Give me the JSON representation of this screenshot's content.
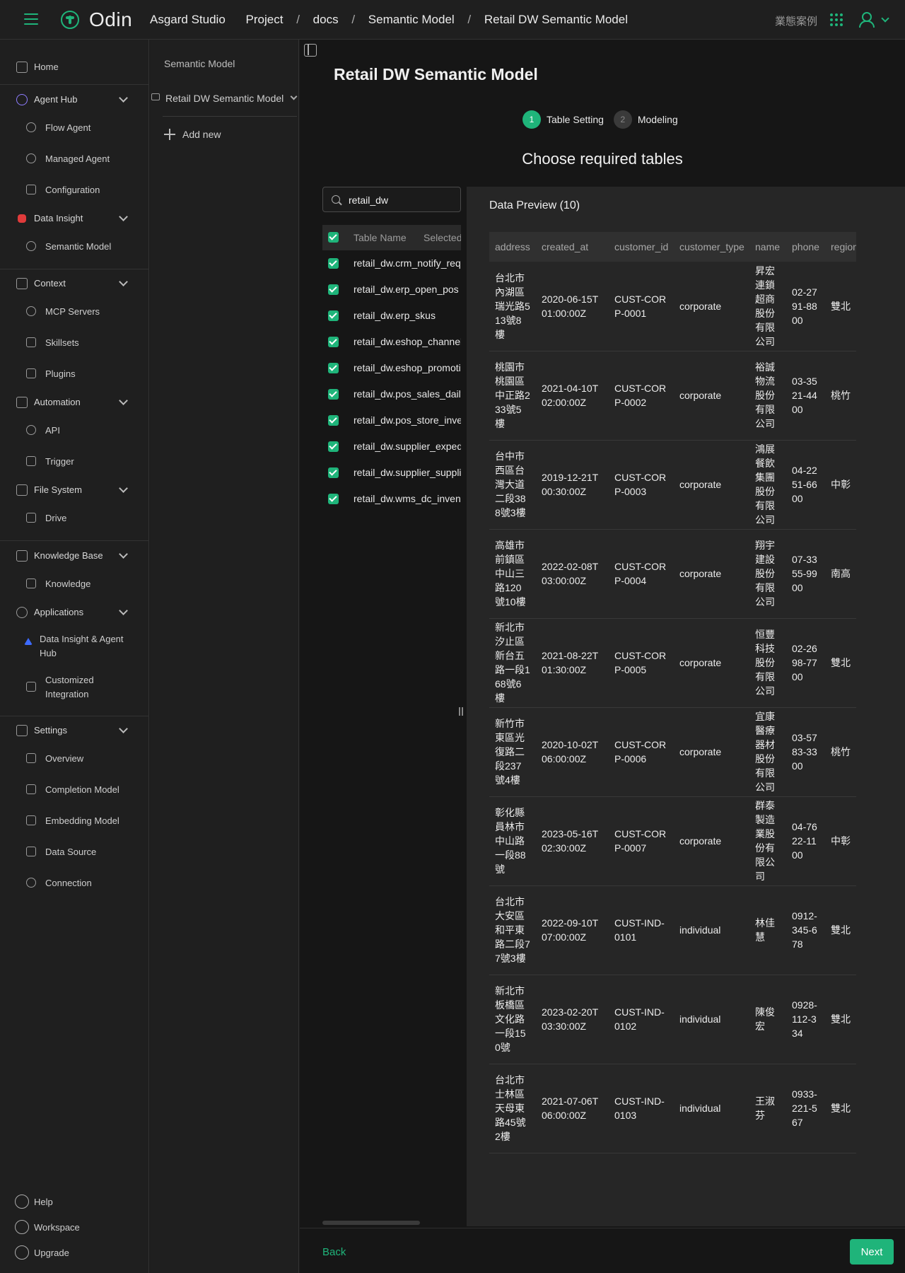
{
  "topbar": {
    "brand": "Odin",
    "studio": "Asgard Studio",
    "breadcrumb": [
      "Project",
      "docs",
      "Semantic Model",
      "Retail DW Semantic Model"
    ],
    "right_text": "業態案例"
  },
  "sidebar": {
    "home": "Home",
    "agent_hub": "Agent Hub",
    "flow_agent": "Flow Agent",
    "managed_agent": "Managed Agent",
    "configuration": "Configuration",
    "data_insight": "Data Insight",
    "semantic_model": "Semantic Model",
    "context": "Context",
    "mcp_servers": "MCP Servers",
    "skillsets": "Skillsets",
    "plugins": "Plugins",
    "automation": "Automation",
    "api": "API",
    "trigger": "Trigger",
    "file_system": "File System",
    "drive": "Drive",
    "knowledge_base": "Knowledge Base",
    "knowledge": "Knowledge",
    "applications": "Applications",
    "data_insight_agent_hub": "Data Insight & Agent Hub",
    "customized_integration": "Customized Integration",
    "settings": "Settings",
    "overview": "Overview",
    "completion_model": "Completion Model",
    "embedding_model": "Embedding Model",
    "data_source": "Data Source",
    "connection": "Connection",
    "help": "Help",
    "workspace": "Workspace",
    "upgrade": "Upgrade"
  },
  "panel2": {
    "title": "Semantic Model",
    "folder": "Retail DW Semantic Model",
    "add_new": "Add new"
  },
  "main": {
    "title": "Retail DW Semantic Model",
    "steps": [
      {
        "num": "1",
        "label": "Table Setting"
      },
      {
        "num": "2",
        "label": "Modeling"
      }
    ],
    "choose_title": "Choose required tables",
    "search_value": "retail_dw",
    "list_headers": [
      "Table Name",
      "Selected"
    ],
    "tables": [
      "retail_dw.crm_notify_requests",
      "retail_dw.erp_open_pos",
      "retail_dw.erp_skus",
      "retail_dw.eshop_channels",
      "retail_dw.eshop_promotions",
      "retail_dw.pos_sales_daily",
      "retail_dw.pos_store_inventory",
      "retail_dw.supplier_expedite",
      "retail_dw.supplier_suppliers",
      "retail_dw.wms_dc_inventory"
    ],
    "back": "Back",
    "next": "Next"
  },
  "preview": {
    "title": "Data Preview (10)",
    "columns": [
      "address",
      "created_at",
      "customer_id",
      "customer_type",
      "name",
      "phone",
      "region"
    ],
    "rows": [
      [
        "台北市內湖區瑞光路513號8樓",
        "2020-06-15T01:00:00Z",
        "CUST-CORP-0001",
        "corporate",
        "昇宏連鎖超商股份有限公司",
        "02-2791-8800",
        "雙北"
      ],
      [
        "桃園市桃園區中正路233號5樓",
        "2021-04-10T02:00:00Z",
        "CUST-CORP-0002",
        "corporate",
        "裕誠物流股份有限公司",
        "03-3521-4400",
        "桃竹"
      ],
      [
        "台中市西區台灣大道二段388號3樓",
        "2019-12-21T00:30:00Z",
        "CUST-CORP-0003",
        "corporate",
        "鴻展餐飲集團股份有限公司",
        "04-2251-6600",
        "中彰"
      ],
      [
        "高雄市前鎮區中山三路120號10樓",
        "2022-02-08T03:00:00Z",
        "CUST-CORP-0004",
        "corporate",
        "翔宇建設股份有限公司",
        "07-3355-9900",
        "南高"
      ],
      [
        "新北市汐止區新台五路一段168號6樓",
        "2021-08-22T01:30:00Z",
        "CUST-CORP-0005",
        "corporate",
        "恒豐科技股份有限公司",
        "02-2698-7700",
        "雙北"
      ],
      [
        "新竹市東區光復路二段237號4樓",
        "2020-10-02T06:00:00Z",
        "CUST-CORP-0006",
        "corporate",
        "宜康醫療器材股份有限公司",
        "03-5783-3300",
        "桃竹"
      ],
      [
        "彰化縣員林市中山路一段88號",
        "2023-05-16T02:30:00Z",
        "CUST-CORP-0007",
        "corporate",
        "群泰製造業股份有限公司",
        "04-7622-1100",
        "中彰"
      ],
      [
        "台北市大安區和平東路二段77號3樓",
        "2022-09-10T07:00:00Z",
        "CUST-IND-0101",
        "individual",
        "林佳慧",
        "0912-345-678",
        "雙北"
      ],
      [
        "新北市板橋區文化路一段150號",
        "2023-02-20T03:30:00Z",
        "CUST-IND-0102",
        "individual",
        "陳俊宏",
        "0928-112-334",
        "雙北"
      ],
      [
        "台北市士林區天母東路45號2樓",
        "2021-07-06T06:00:00Z",
        "CUST-IND-0103",
        "individual",
        "王淑芬",
        "0933-221-567",
        "雙北"
      ]
    ]
  },
  "colors": {
    "accent": "#1fb47a",
    "background": "#161616",
    "panel": "#1f1f1f"
  }
}
